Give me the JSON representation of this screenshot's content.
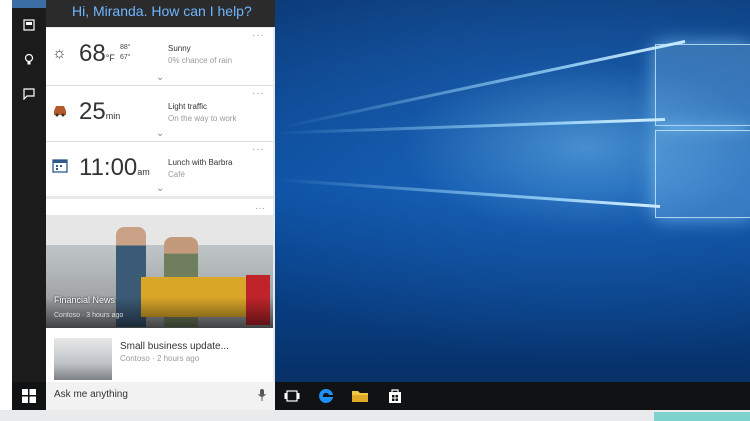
{
  "cortana": {
    "greeting": "Hi, Miranda. How can I help?",
    "weather": {
      "temp": "68",
      "unit": "°F",
      "high": "88°",
      "low": "67°",
      "condition": "Sunny",
      "detail": "0% chance of rain"
    },
    "traffic": {
      "minutes": "25",
      "unit": "min",
      "title": "Light traffic",
      "detail": "On the way to work"
    },
    "calendar": {
      "time": "11:00",
      "ampm": "am",
      "title": "Lunch with Barbra",
      "detail": "Café"
    },
    "news_main": {
      "title": "Financial News",
      "meta": "Contoso · 3 hours ago"
    },
    "news_small": {
      "title": "Small business update...",
      "meta": "Contoso · 2 hours ago"
    }
  },
  "taskbar": {
    "search_placeholder": "Ask me anything"
  },
  "colors": {
    "greeting": "#6fb6ff",
    "rail": "#1b1b1b",
    "taskbar": "#101214",
    "edge": "#1e90ff",
    "explorer": "#f2c744"
  }
}
